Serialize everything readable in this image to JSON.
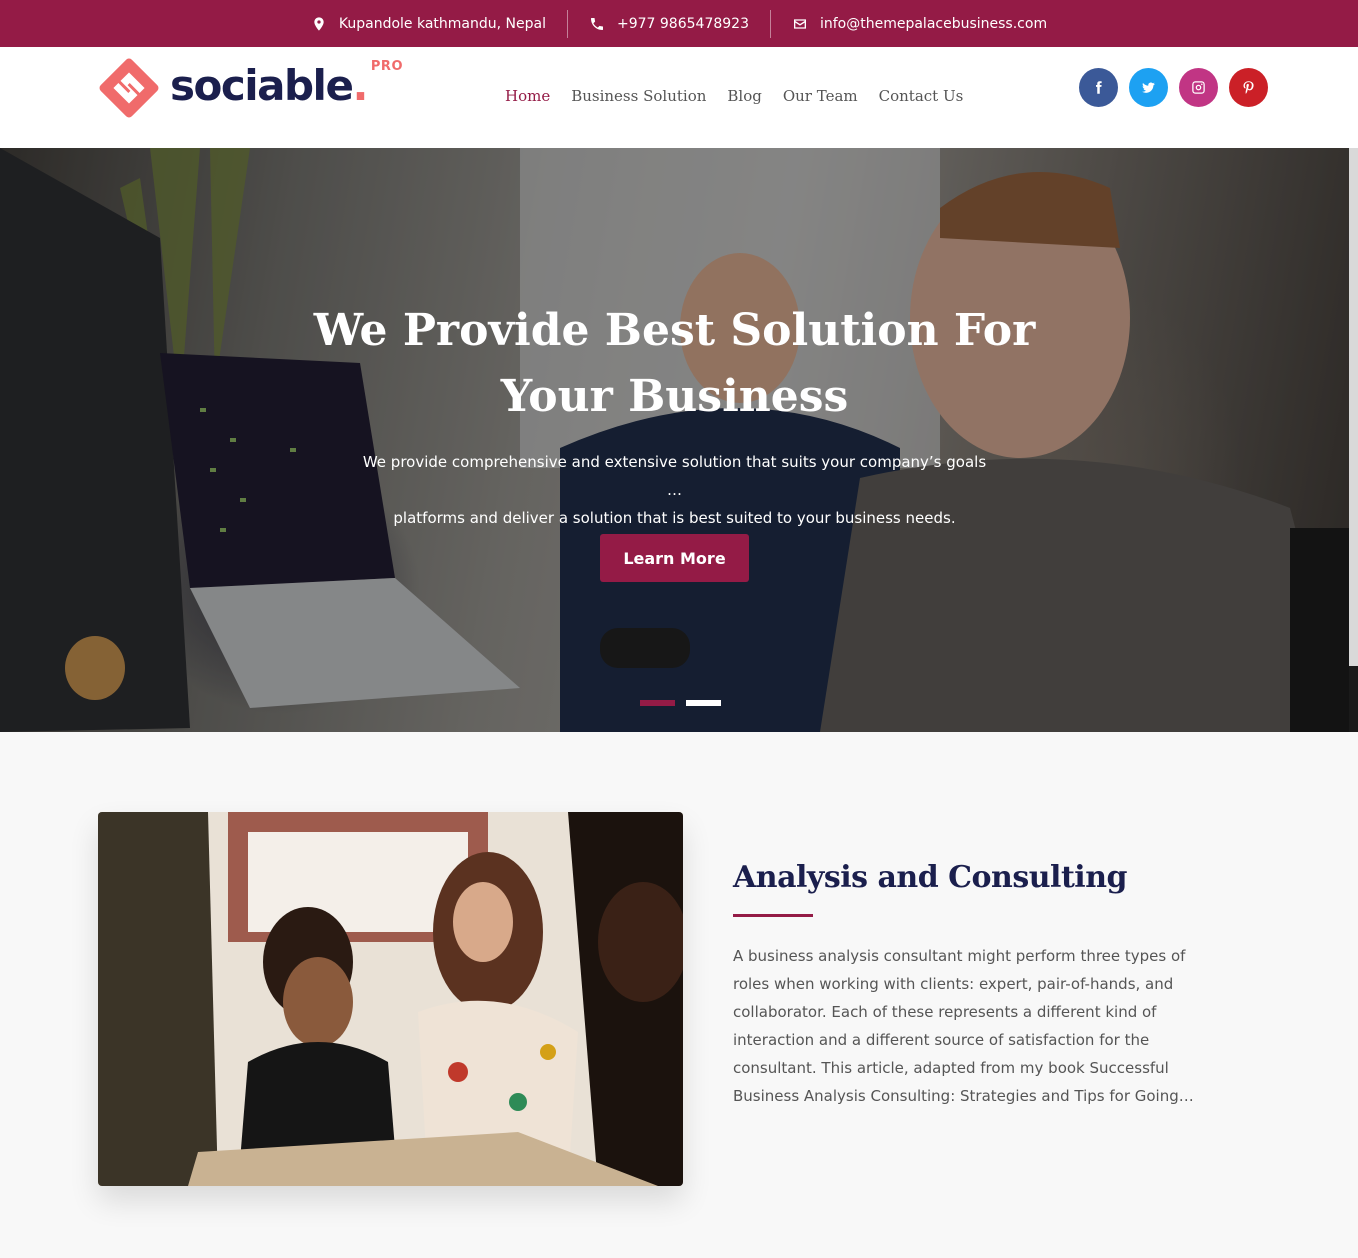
{
  "topbar": {
    "address": "Kupandole kathmandu, Nepal",
    "phone": "+977 9865478923",
    "email": "info@themepalacebusiness.com",
    "background": "#941b46"
  },
  "header": {
    "logo_text": "sociable",
    "logo_dot": ".",
    "logo_badge": "PRO",
    "nav": [
      {
        "label": "Home",
        "active": true
      },
      {
        "label": "Business Solution"
      },
      {
        "label": "Blog"
      },
      {
        "label": "Our Team"
      },
      {
        "label": "Contact Us"
      }
    ],
    "social": [
      {
        "icon": "facebook-icon",
        "color": "#3b5998"
      },
      {
        "icon": "twitter-icon",
        "color": "#1da1f2"
      },
      {
        "icon": "instagram-icon",
        "color": "#c13584"
      },
      {
        "icon": "pinterest-icon",
        "color": "#cb2027"
      }
    ]
  },
  "hero": {
    "title_line1": "We Provide Best Solution For",
    "title_line2": "Your Business",
    "subtitle_line1": "We provide comprehensive and extensive solution that suits your company’s goals …",
    "subtitle_line2": "platforms and deliver a solution that is best suited to your business needs.",
    "button": "Learn More",
    "slides": 2,
    "active_slide": 1
  },
  "feature": {
    "title": "Analysis and Consulting",
    "body": "A business analysis consultant might perform three types of roles when working with clients: expert, pair-of-hands, and collaborator. Each of these represents a different kind of interaction and a different source of satisfaction for the consultant. This article, adapted from my book Successful Business Analysis Consulting: Strategies and Tips for Going…"
  }
}
